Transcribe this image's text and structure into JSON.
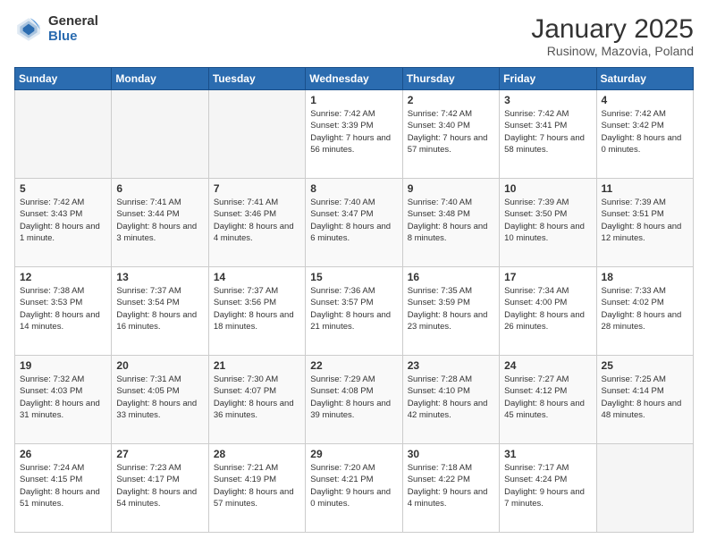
{
  "header": {
    "logo_general": "General",
    "logo_blue": "Blue",
    "title": "January 2025",
    "subtitle": "Rusinow, Mazovia, Poland"
  },
  "weekdays": [
    "Sunday",
    "Monday",
    "Tuesday",
    "Wednesday",
    "Thursday",
    "Friday",
    "Saturday"
  ],
  "weeks": [
    [
      {
        "empty": true
      },
      {
        "empty": true
      },
      {
        "empty": true
      },
      {
        "day": 1,
        "sunrise": "7:42 AM",
        "sunset": "3:39 PM",
        "daylight": "7 hours and 56 minutes."
      },
      {
        "day": 2,
        "sunrise": "7:42 AM",
        "sunset": "3:40 PM",
        "daylight": "7 hours and 57 minutes."
      },
      {
        "day": 3,
        "sunrise": "7:42 AM",
        "sunset": "3:41 PM",
        "daylight": "7 hours and 58 minutes."
      },
      {
        "day": 4,
        "sunrise": "7:42 AM",
        "sunset": "3:42 PM",
        "daylight": "8 hours and 0 minutes."
      }
    ],
    [
      {
        "day": 5,
        "sunrise": "7:42 AM",
        "sunset": "3:43 PM",
        "daylight": "8 hours and 1 minute."
      },
      {
        "day": 6,
        "sunrise": "7:41 AM",
        "sunset": "3:44 PM",
        "daylight": "8 hours and 3 minutes."
      },
      {
        "day": 7,
        "sunrise": "7:41 AM",
        "sunset": "3:46 PM",
        "daylight": "8 hours and 4 minutes."
      },
      {
        "day": 8,
        "sunrise": "7:40 AM",
        "sunset": "3:47 PM",
        "daylight": "8 hours and 6 minutes."
      },
      {
        "day": 9,
        "sunrise": "7:40 AM",
        "sunset": "3:48 PM",
        "daylight": "8 hours and 8 minutes."
      },
      {
        "day": 10,
        "sunrise": "7:39 AM",
        "sunset": "3:50 PM",
        "daylight": "8 hours and 10 minutes."
      },
      {
        "day": 11,
        "sunrise": "7:39 AM",
        "sunset": "3:51 PM",
        "daylight": "8 hours and 12 minutes."
      }
    ],
    [
      {
        "day": 12,
        "sunrise": "7:38 AM",
        "sunset": "3:53 PM",
        "daylight": "8 hours and 14 minutes."
      },
      {
        "day": 13,
        "sunrise": "7:37 AM",
        "sunset": "3:54 PM",
        "daylight": "8 hours and 16 minutes."
      },
      {
        "day": 14,
        "sunrise": "7:37 AM",
        "sunset": "3:56 PM",
        "daylight": "8 hours and 18 minutes."
      },
      {
        "day": 15,
        "sunrise": "7:36 AM",
        "sunset": "3:57 PM",
        "daylight": "8 hours and 21 minutes."
      },
      {
        "day": 16,
        "sunrise": "7:35 AM",
        "sunset": "3:59 PM",
        "daylight": "8 hours and 23 minutes."
      },
      {
        "day": 17,
        "sunrise": "7:34 AM",
        "sunset": "4:00 PM",
        "daylight": "8 hours and 26 minutes."
      },
      {
        "day": 18,
        "sunrise": "7:33 AM",
        "sunset": "4:02 PM",
        "daylight": "8 hours and 28 minutes."
      }
    ],
    [
      {
        "day": 19,
        "sunrise": "7:32 AM",
        "sunset": "4:03 PM",
        "daylight": "8 hours and 31 minutes."
      },
      {
        "day": 20,
        "sunrise": "7:31 AM",
        "sunset": "4:05 PM",
        "daylight": "8 hours and 33 minutes."
      },
      {
        "day": 21,
        "sunrise": "7:30 AM",
        "sunset": "4:07 PM",
        "daylight": "8 hours and 36 minutes."
      },
      {
        "day": 22,
        "sunrise": "7:29 AM",
        "sunset": "4:08 PM",
        "daylight": "8 hours and 39 minutes."
      },
      {
        "day": 23,
        "sunrise": "7:28 AM",
        "sunset": "4:10 PM",
        "daylight": "8 hours and 42 minutes."
      },
      {
        "day": 24,
        "sunrise": "7:27 AM",
        "sunset": "4:12 PM",
        "daylight": "8 hours and 45 minutes."
      },
      {
        "day": 25,
        "sunrise": "7:25 AM",
        "sunset": "4:14 PM",
        "daylight": "8 hours and 48 minutes."
      }
    ],
    [
      {
        "day": 26,
        "sunrise": "7:24 AM",
        "sunset": "4:15 PM",
        "daylight": "8 hours and 51 minutes."
      },
      {
        "day": 27,
        "sunrise": "7:23 AM",
        "sunset": "4:17 PM",
        "daylight": "8 hours and 54 minutes."
      },
      {
        "day": 28,
        "sunrise": "7:21 AM",
        "sunset": "4:19 PM",
        "daylight": "8 hours and 57 minutes."
      },
      {
        "day": 29,
        "sunrise": "7:20 AM",
        "sunset": "4:21 PM",
        "daylight": "9 hours and 0 minutes."
      },
      {
        "day": 30,
        "sunrise": "7:18 AM",
        "sunset": "4:22 PM",
        "daylight": "9 hours and 4 minutes."
      },
      {
        "day": 31,
        "sunrise": "7:17 AM",
        "sunset": "4:24 PM",
        "daylight": "9 hours and 7 minutes."
      },
      {
        "empty": true
      }
    ]
  ]
}
